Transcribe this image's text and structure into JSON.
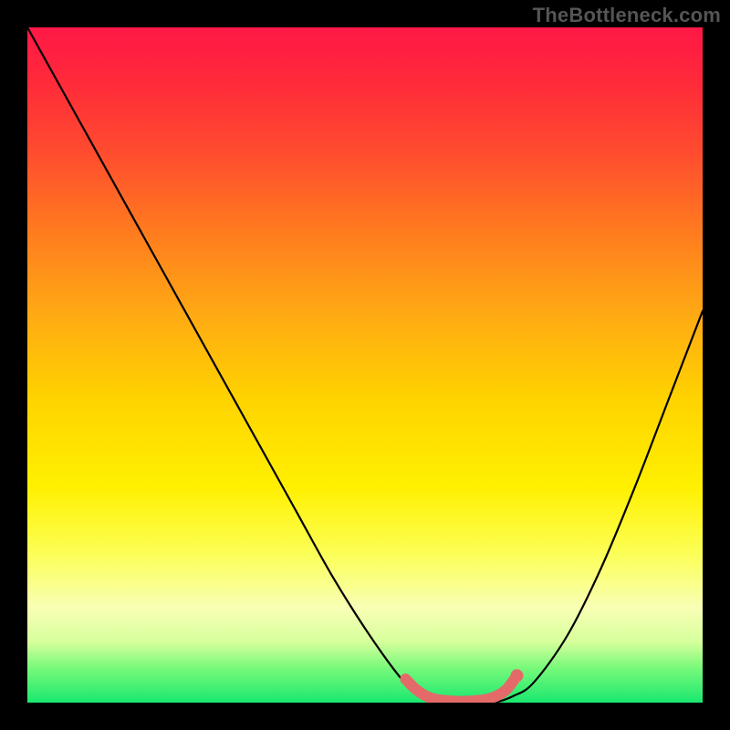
{
  "attribution": "TheBottleneck.com",
  "chart_data": {
    "type": "line",
    "title": "",
    "xlabel": "",
    "ylabel": "",
    "xlim": [
      0,
      100
    ],
    "ylim": [
      0,
      100
    ],
    "series": [
      {
        "name": "bottleneck-curve",
        "x": [
          0,
          5,
          10,
          15,
          20,
          25,
          30,
          35,
          40,
          45,
          50,
          55,
          58,
          60,
          63,
          66,
          69,
          72,
          75,
          80,
          85,
          90,
          95,
          100
        ],
        "y": [
          100,
          91,
          82,
          73,
          64,
          55,
          46,
          37,
          28,
          19,
          11,
          4,
          1,
          0,
          0,
          0,
          0,
          1,
          3,
          10,
          20,
          32,
          45,
          58
        ]
      }
    ],
    "highlight": {
      "name": "optimal-zone",
      "points": [
        {
          "x": 56.0,
          "y": 3.5
        },
        {
          "x": 57.5,
          "y": 2.0
        },
        {
          "x": 59.0,
          "y": 1.0
        },
        {
          "x": 60.5,
          "y": 0.5
        },
        {
          "x": 62.0,
          "y": 0.3
        },
        {
          "x": 63.5,
          "y": 0.2
        },
        {
          "x": 65.0,
          "y": 0.2
        },
        {
          "x": 66.5,
          "y": 0.3
        },
        {
          "x": 68.0,
          "y": 0.5
        },
        {
          "x": 69.5,
          "y": 1.0
        },
        {
          "x": 71.0,
          "y": 2.0
        },
        {
          "x": 72.5,
          "y": 4.0
        }
      ],
      "end_marker": {
        "x": 72.5,
        "y": 4.0
      }
    },
    "colors": {
      "curve": "#000000",
      "highlight": "#e46a6a",
      "gradient_top": "#ff1846",
      "gradient_mid": "#fff000",
      "gradient_bottom": "#19e86f"
    }
  }
}
